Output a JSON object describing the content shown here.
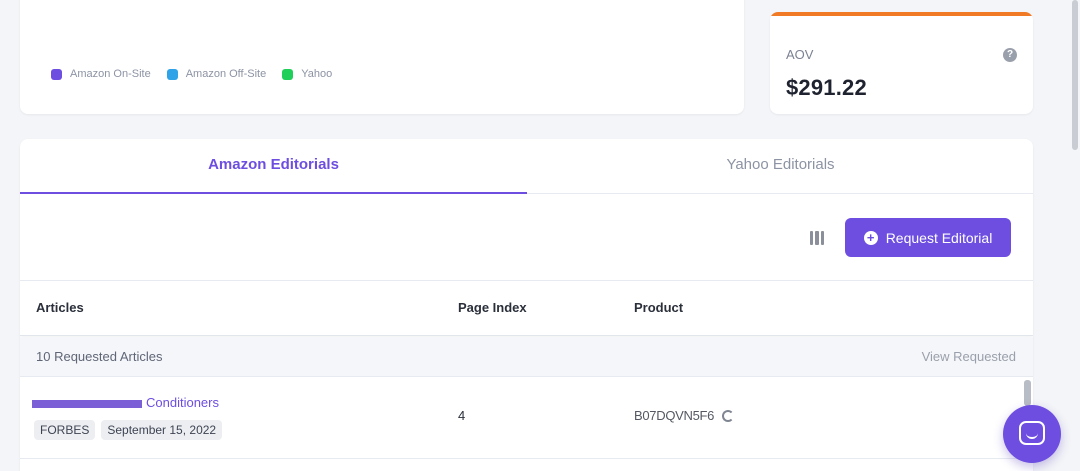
{
  "legend": [
    {
      "label": "Amazon On-Site",
      "color": "#6d4ee0"
    },
    {
      "label": "Amazon Off-Site",
      "color": "#2ea3e8"
    },
    {
      "label": "Yahoo",
      "color": "#1fcf5a"
    }
  ],
  "aov": {
    "label": "AOV",
    "value": "$291.22",
    "accent": "#f07a25"
  },
  "tabs": [
    {
      "label": "Amazon Editorials",
      "active": true
    },
    {
      "label": "Yahoo Editorials",
      "active": false
    }
  ],
  "toolbar": {
    "request_label": "Request Editorial"
  },
  "table": {
    "headers": {
      "articles": "Articles",
      "page_index": "Page Index",
      "product": "Product"
    },
    "summary": {
      "count": "10 Requested Articles",
      "view": "View Requested"
    },
    "rows": [
      {
        "title_visible": "Conditioners",
        "tags": [
          "FORBES",
          "September 15, 2022"
        ],
        "page_index": "4",
        "product": "B07DQVN5F6"
      }
    ]
  },
  "colors": {
    "primary": "#6d4ee0",
    "accent": "#f07a25"
  }
}
